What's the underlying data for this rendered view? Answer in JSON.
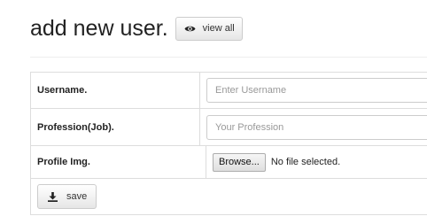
{
  "header": {
    "title": "add new user.",
    "view_all_label": "view all",
    "view_all_icon": "eye-icon"
  },
  "form": {
    "username": {
      "label": "Username.",
      "placeholder": "Enter Username",
      "value": ""
    },
    "profession": {
      "label": "Profession(Job).",
      "placeholder": "Your Profession",
      "value": ""
    },
    "profile_img": {
      "label": "Profile Img.",
      "browse_label": "Browse...",
      "status": "No file selected."
    },
    "save": {
      "label": "save",
      "icon": "download-icon"
    }
  }
}
